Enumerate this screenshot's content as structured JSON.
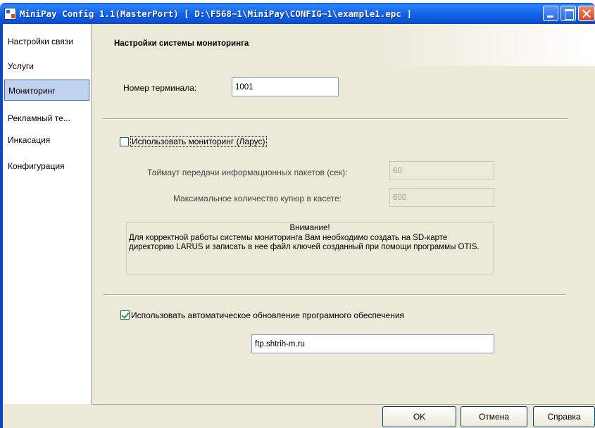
{
  "window": {
    "title": "MiniPay Config 1.1(MasterPort) [ D:\\F568~1\\MiniPay\\CONFIG~1\\example1.epc ]"
  },
  "nav": {
    "items": [
      {
        "label": "Настройки связи"
      },
      {
        "label": "Услуги"
      },
      {
        "label": "Мониторинг",
        "selected": true
      },
      {
        "label": "Рекламный те..."
      },
      {
        "label": "Инкасация"
      },
      {
        "label": "Конфигурация"
      }
    ]
  },
  "monitoring": {
    "section_title": "Настройки системы мониторинга",
    "terminal_label": "Номер терминала:",
    "terminal_value": "1001",
    "use_monitoring_label": "Использовать мониторинг (Ларус)",
    "use_monitoring_checked": false,
    "timeout_label": "Таймаут передачи информационных пакетов (сек):",
    "timeout_value": "60",
    "max_notes_label": "Максимальное количество купюр в касете:",
    "max_notes_value": "600",
    "notice_title": "Внимание!",
    "notice_text": "Для корректной работы системы мониторинга Вам необходимо создать на SD-карте директорию LARUS и записать в нее файл ключей созданный при помощи программы OTIS.",
    "auto_update_label": "Использовать автоматическое обновление програмного обеспечения",
    "auto_update_checked": true,
    "update_server_value": "ftp.shtrih-m.ru"
  },
  "buttons": {
    "ok": "OK",
    "cancel": "Отмена",
    "help": "Справка"
  },
  "colors": {
    "titlebar": "#0a5fe0",
    "dialog_bg": "#ece9d8",
    "nav_selected": "#c1d2ee",
    "checkbox_check": "#21a121"
  }
}
